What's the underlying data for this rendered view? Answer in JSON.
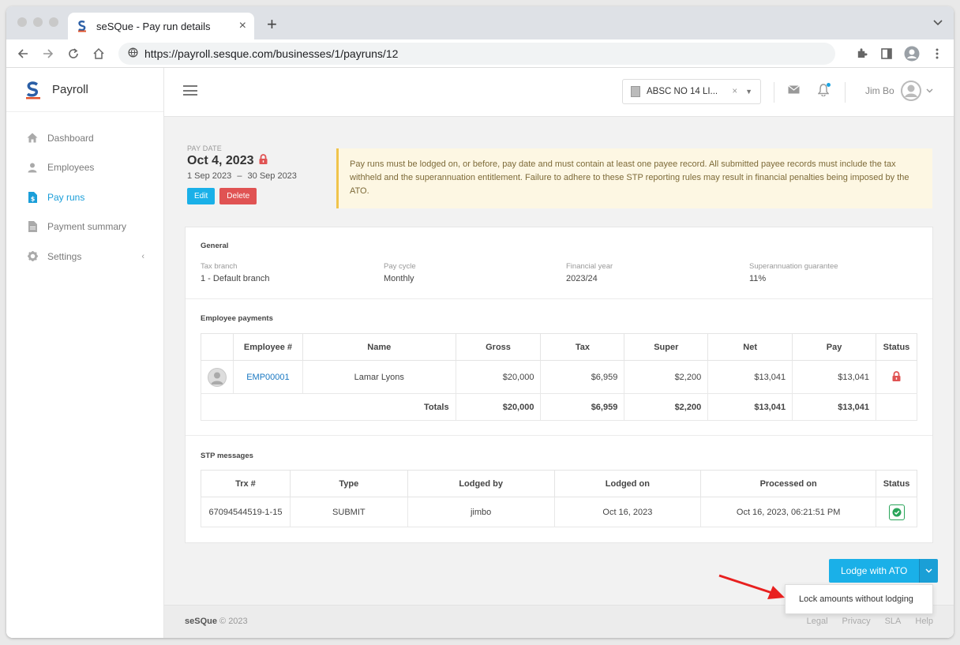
{
  "browser": {
    "tab_title": "seSQue - Pay run details",
    "url": "https://payroll.sesque.com/businesses/1/payruns/12"
  },
  "sidebar": {
    "brand": "Payroll",
    "items": [
      {
        "label": "Dashboard",
        "icon": "home-icon"
      },
      {
        "label": "Employees",
        "icon": "user-icon"
      },
      {
        "label": "Pay runs",
        "icon": "document-dollar-icon",
        "active": true
      },
      {
        "label": "Payment summary",
        "icon": "document-icon"
      },
      {
        "label": "Settings",
        "icon": "gear-icon"
      }
    ]
  },
  "header": {
    "business": "ABSC NO 14 LI...",
    "user": "Jim Bo"
  },
  "payrun": {
    "date_label": "PAY DATE",
    "date": "Oct 4, 2023",
    "period_start": "1 Sep 2023",
    "period_sep": "–",
    "period_end": "30 Sep 2023",
    "edit_label": "Edit",
    "delete_label": "Delete"
  },
  "alert": "Pay runs must be lodged on, or before, pay date and must contain at least one payee record. All submitted payee records must include the tax withheld and the superannuation entitlement. Failure to adhere to these STP reporting rules may result in financial penalties being imposed by the ATO.",
  "general": {
    "title": "General",
    "fields": [
      {
        "label": "Tax branch",
        "value": "1 - Default branch"
      },
      {
        "label": "Pay cycle",
        "value": "Monthly"
      },
      {
        "label": "Financial year",
        "value": "2023/24"
      },
      {
        "label": "Superannuation guarantee",
        "value": "11%"
      }
    ]
  },
  "payments": {
    "title": "Employee payments",
    "headers": [
      "Employee #",
      "Name",
      "Gross",
      "Tax",
      "Super",
      "Net",
      "Pay",
      "Status"
    ],
    "row": {
      "id": "EMP00001",
      "name": "Lamar Lyons",
      "gross": "$20,000",
      "tax": "$6,959",
      "super": "$2,200",
      "net": "$13,041",
      "pay": "$13,041"
    },
    "totals": {
      "label": "Totals",
      "gross": "$20,000",
      "tax": "$6,959",
      "super": "$2,200",
      "net": "$13,041",
      "pay": "$13,041"
    }
  },
  "stp": {
    "title": "STP messages",
    "headers": [
      "Trx #",
      "Type",
      "Lodged by",
      "Lodged on",
      "Processed on",
      "Status"
    ],
    "row": {
      "trx": "67094544519-1-15",
      "type": "SUBMIT",
      "by": "jimbo",
      "on": "Oct 16, 2023",
      "processed": "Oct 16, 2023, 06:21:51 PM"
    }
  },
  "lodge": {
    "button": "Lodge with ATO",
    "dropdown_item": "Lock amounts without lodging"
  },
  "footer": {
    "brand": "seSQue",
    "copyright": "© 2023",
    "links": [
      "Legal",
      "Privacy",
      "SLA",
      "Help"
    ]
  },
  "colors": {
    "accent": "#1ab0e8",
    "danger": "#e05353",
    "success": "#2aa55a",
    "alert_bg": "#fdf7e3"
  }
}
